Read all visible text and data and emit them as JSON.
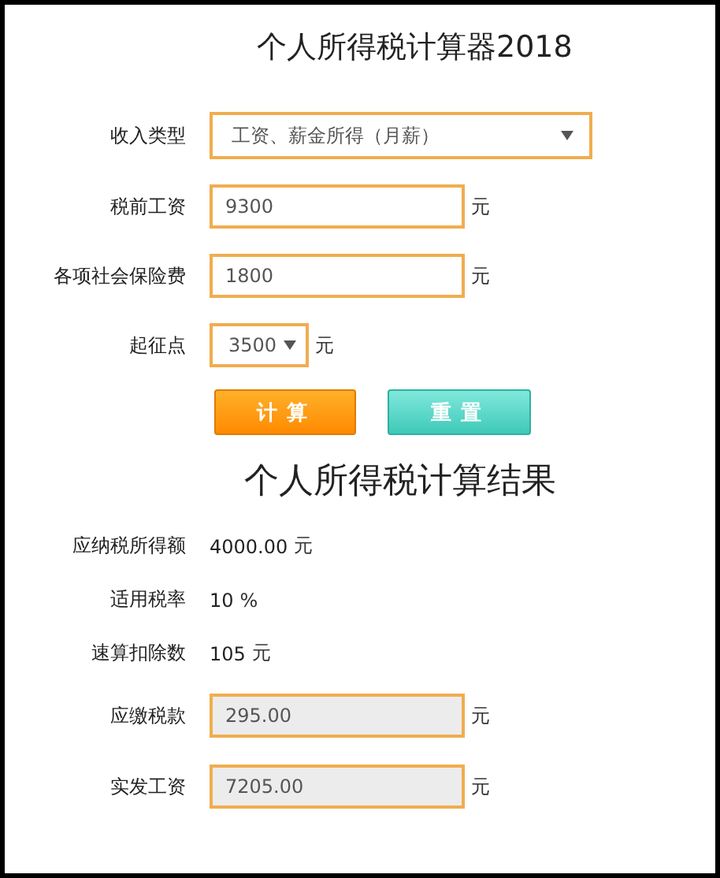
{
  "title": "个人所得税计算器2018",
  "inputs": [
    {
      "kind": "select",
      "label": "收入类型",
      "value": "工资、薪金所得（月薪）"
    },
    {
      "kind": "input",
      "label": "税前工资",
      "value": "9300",
      "unit": "元"
    },
    {
      "kind": "input",
      "label": "各项社会保险费",
      "value": "1800",
      "unit": "元"
    },
    {
      "kind": "small-select",
      "label": "起征点",
      "value": "3500",
      "unit": "元"
    }
  ],
  "buttons": [
    {
      "label": "计算",
      "kind": "primary"
    },
    {
      "label": "重置",
      "kind": "secondary"
    }
  ],
  "result_title": "个人所得税计算结果",
  "results": [
    {
      "kind": "text",
      "label": "应纳税所得额",
      "value": "4000.00",
      "unit": "元"
    },
    {
      "kind": "text",
      "label": "适用税率",
      "value": "10",
      "unit": "%"
    },
    {
      "kind": "text",
      "label": "速算扣除数",
      "value": "105",
      "unit": "元"
    },
    {
      "kind": "output",
      "label": "应缴税款",
      "value": "295.00",
      "unit": "元"
    },
    {
      "kind": "output",
      "label": "实发工资",
      "value": "7205.00",
      "unit": "元"
    }
  ]
}
